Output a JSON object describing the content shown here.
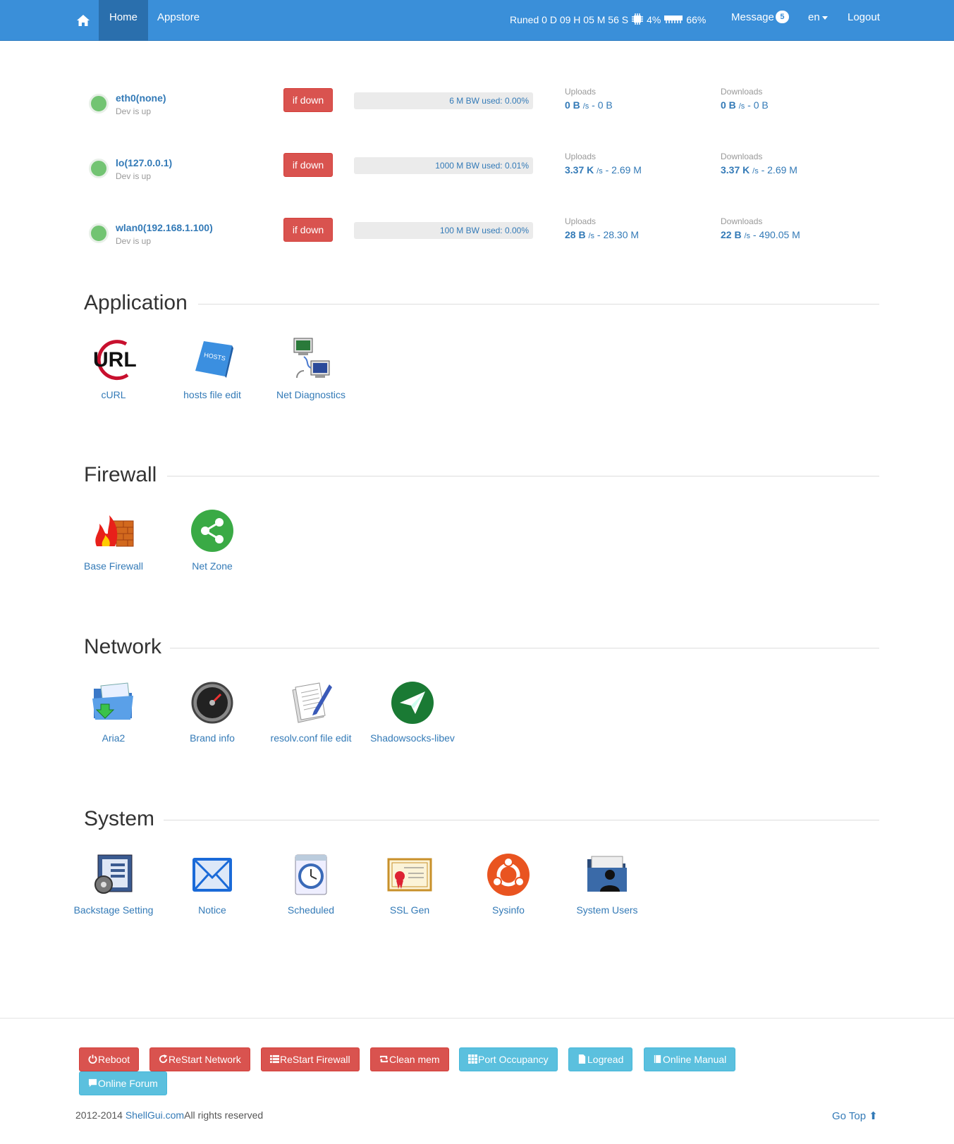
{
  "nav": {
    "tabs": [
      "Home",
      "Appstore"
    ],
    "status": {
      "uptime": "Runed 0 D 09 H 05 M 56 S",
      "cpu": "4%",
      "mem": "66%"
    },
    "message_label": "Message",
    "message_count": "5",
    "lang": "en",
    "logout": "Logout"
  },
  "interfaces": [
    {
      "name": "eth0(none)",
      "status": "Dev is up",
      "action": "if down",
      "bw_text": "6 M BW used: 0.00%",
      "bw_fraction": 0.0,
      "uploads_label": "Uploads",
      "up_rate": "0 B",
      "up_unit": "/s",
      "up_total": " - 0 B",
      "downloads_label": "Downloads",
      "down_rate": "0 B",
      "down_unit": "/s",
      "down_total": " - 0 B"
    },
    {
      "name": "lo(127.0.0.1)",
      "status": "Dev is up",
      "action": "if down",
      "bw_text": "1000 M BW used: 0.01%",
      "bw_fraction": 0.0001,
      "uploads_label": "Uploads",
      "up_rate": "3.37 K",
      "up_unit": "/s",
      "up_total": " - 2.69 M",
      "downloads_label": "Downloads",
      "down_rate": "3.37 K",
      "down_unit": "/s",
      "down_total": " - 2.69 M"
    },
    {
      "name": "wlan0(192.168.1.100)",
      "status": "Dev is up",
      "action": "if down",
      "bw_text": "100 M BW used: 0.00%",
      "bw_fraction": 0.0,
      "uploads_label": "Uploads",
      "up_rate": "28 B",
      "up_unit": "/s",
      "up_total": " - 28.30 M",
      "downloads_label": "Downloads",
      "down_rate": "22 B",
      "down_unit": "/s",
      "down_total": " - 490.05 M"
    }
  ],
  "sections": {
    "application": {
      "title": "Application",
      "apps": [
        "cURL",
        "hosts file edit",
        "Net Diagnostics"
      ]
    },
    "firewall": {
      "title": "Firewall",
      "apps": [
        "Base Firewall",
        "Net Zone"
      ]
    },
    "network": {
      "title": "Network",
      "apps": [
        "Aria2",
        "Brand info",
        "resolv.conf file edit",
        "Shadowsocks-libev"
      ]
    },
    "system": {
      "title": "System",
      "apps": [
        "Backstage Setting",
        "Notice",
        "Scheduled",
        "SSL Gen",
        "Sysinfo",
        "System Users"
      ]
    }
  },
  "icon_texts": {
    "curl": "URL",
    "hosts": "HOSTS"
  },
  "footer": {
    "buttons": [
      "Reboot",
      "ReStart Network",
      "ReStart Firewall",
      "Clean mem",
      "Port Occupancy",
      "Logread",
      "Online Manual",
      "Online Forum"
    ],
    "copyright_prefix": "2012-2014 ",
    "copyright_link": "ShellGui.com",
    "copyright_suffix": "All rights reserved",
    "gotop": "Go Top"
  },
  "colors": {
    "navbar": "#3a8fd9",
    "danger": "#d9534f",
    "info": "#5bc0de",
    "link": "#337ab7"
  }
}
